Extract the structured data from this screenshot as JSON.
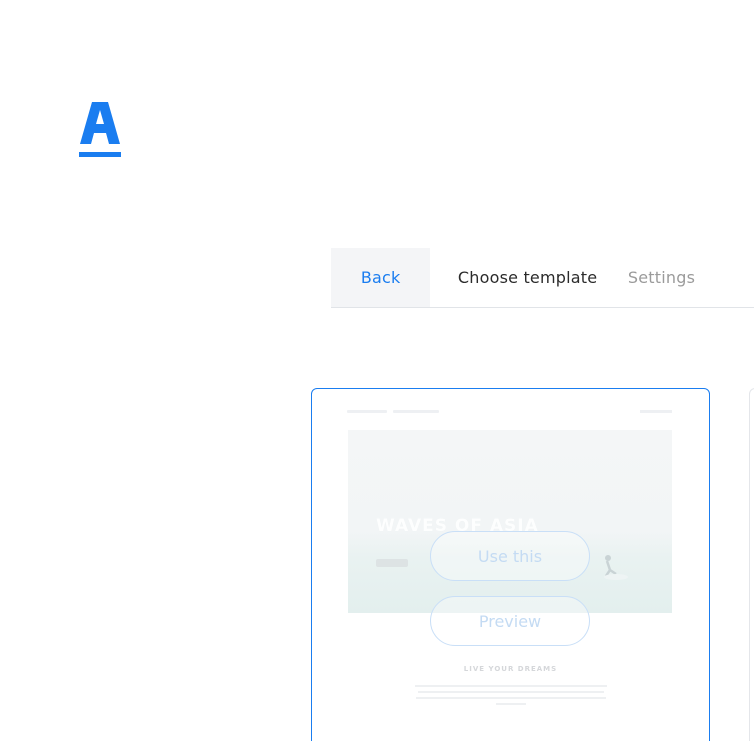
{
  "brand": {
    "logo_letter": "A",
    "accent": "#1a7df0"
  },
  "tabs": [
    {
      "label": "Back",
      "state": "active"
    },
    {
      "label": "Choose template",
      "state": "current"
    },
    {
      "label": "Settings",
      "state": "disabled"
    }
  ],
  "template_card": {
    "preview": {
      "hero_title": "WAVES OF ASIA",
      "section_title": "LIVE YOUR DREAMS"
    },
    "use_button": "Use this",
    "preview_button": "Preview"
  }
}
